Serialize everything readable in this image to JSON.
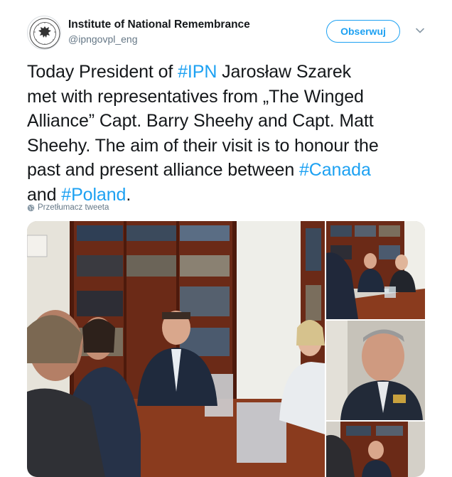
{
  "account": {
    "name": "Institute of National Remembrance",
    "handle": "@ipngovpl_eng",
    "avatar_icon": "eagle-seal-icon"
  },
  "actions": {
    "follow_label": "Obserwuj",
    "menu_icon": "chevron-down-icon"
  },
  "tweet": {
    "line1_a": "Today President of ",
    "line1_tag": "#IPN",
    "line1_b": " Jarosław Szarek",
    "line2": "met with representatives from „The Winged",
    "line3": "Alliance” Capt. Barry Sheehy and Capt. Matt",
    "line4": "Sheehy. The aim of their visit is to honour the",
    "line5_a": "past and present alliance between ",
    "line5_tag": "#Canada",
    "line6_a": "and ",
    "line6_tag": "#Poland",
    "line6_b": "."
  },
  "translate": {
    "label": "Przetłumacz tweeta",
    "icon": "globe-icon"
  },
  "colors": {
    "accent": "#1da1f2",
    "text": "#14171a",
    "muted": "#657786"
  }
}
